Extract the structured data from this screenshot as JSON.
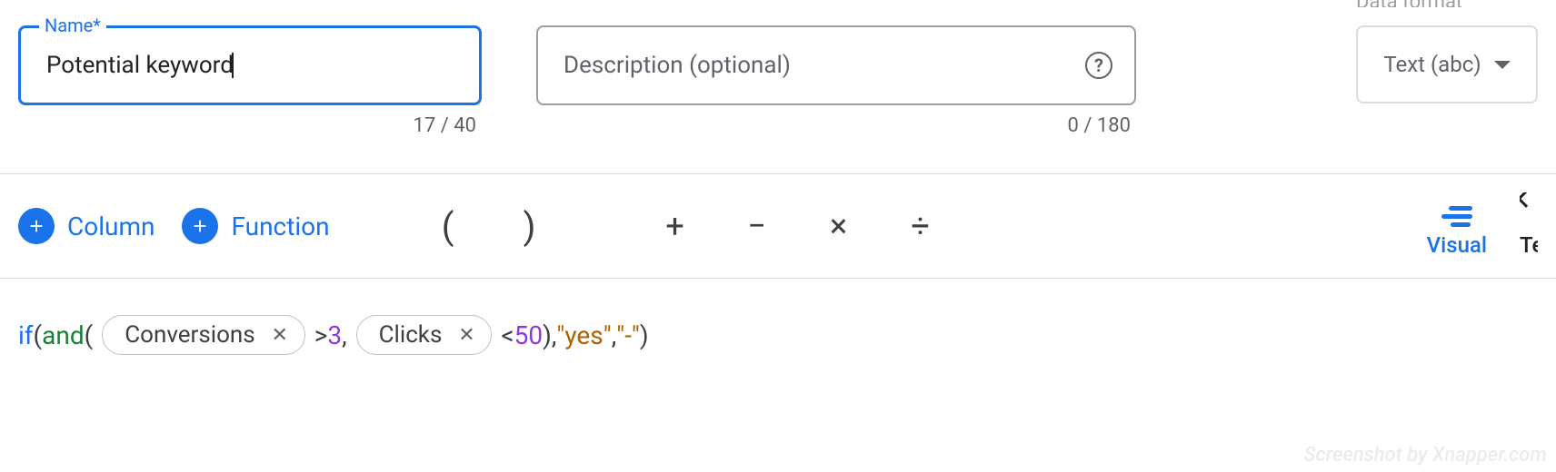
{
  "fields": {
    "name": {
      "label": "Name*",
      "value": "Potential keyword",
      "counter": "17 / 40"
    },
    "description": {
      "placeholder": "Description (optional)",
      "counter": "0 / 180"
    },
    "format": {
      "label_cut": "Data format",
      "value": "Text (abc)"
    }
  },
  "toolbar": {
    "column_label": "Column",
    "function_label": "Function",
    "ops": {
      "lparen": "(",
      "rparen": ")",
      "plus": "+",
      "minus": "−",
      "mult": "×",
      "div": "÷"
    },
    "mode": {
      "visual": "Visual",
      "text": "Text"
    }
  },
  "formula": {
    "fn_if": "if",
    "lparen1": "(",
    "fn_and": "and",
    "lparen2": "(",
    "chip1": "Conversions",
    "cmp1": " > ",
    "num1": "3",
    "comma1": ", ",
    "chip2": "Clicks",
    "cmp2": " < ",
    "num2": "50",
    "rparen2": ")",
    "comma2": ", ",
    "str1": "\"yes\"",
    "comma3": ", ",
    "str2": "\"-\"",
    "rparen1": ")"
  },
  "watermark": "Screenshot by Xnapper.com"
}
